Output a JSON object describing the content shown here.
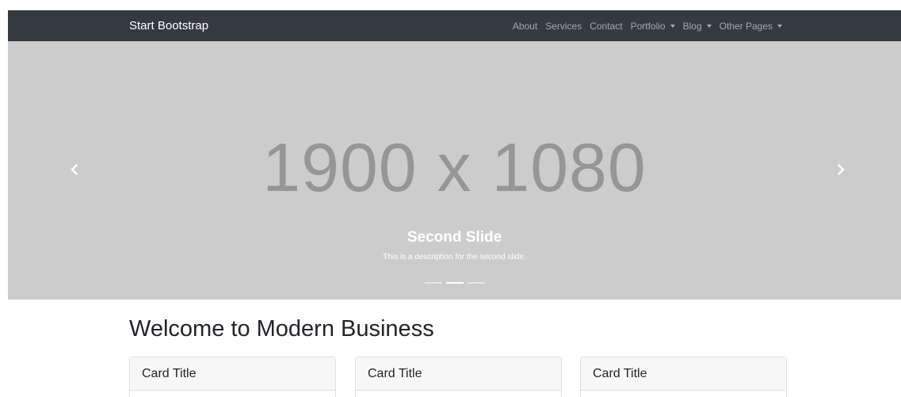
{
  "navbar": {
    "brand": "Start Bootstrap",
    "links": [
      {
        "label": "About"
      },
      {
        "label": "Services"
      },
      {
        "label": "Contact"
      },
      {
        "label": "Portfolio"
      },
      {
        "label": "Blog"
      },
      {
        "label": "Other Pages"
      }
    ]
  },
  "carousel": {
    "placeholder_text": "1900 x 1080",
    "caption_title": "Second Slide",
    "caption_description": "This is a description for the second slide.",
    "indicators_count": 3,
    "active_indicator": 2,
    "prev_icon": "chevron-left-icon",
    "next_icon": "chevron-right-icon"
  },
  "main": {
    "heading": "Welcome to Modern Business",
    "cards": [
      {
        "title": "Card Title"
      },
      {
        "title": "Card Title"
      },
      {
        "title": "Card Title"
      }
    ]
  },
  "colors": {
    "navbar_bg": "#343a40",
    "carousel_bg": "#cccccc",
    "placeholder_text": "#969696",
    "card_header_bg": "#f7f7f7"
  }
}
